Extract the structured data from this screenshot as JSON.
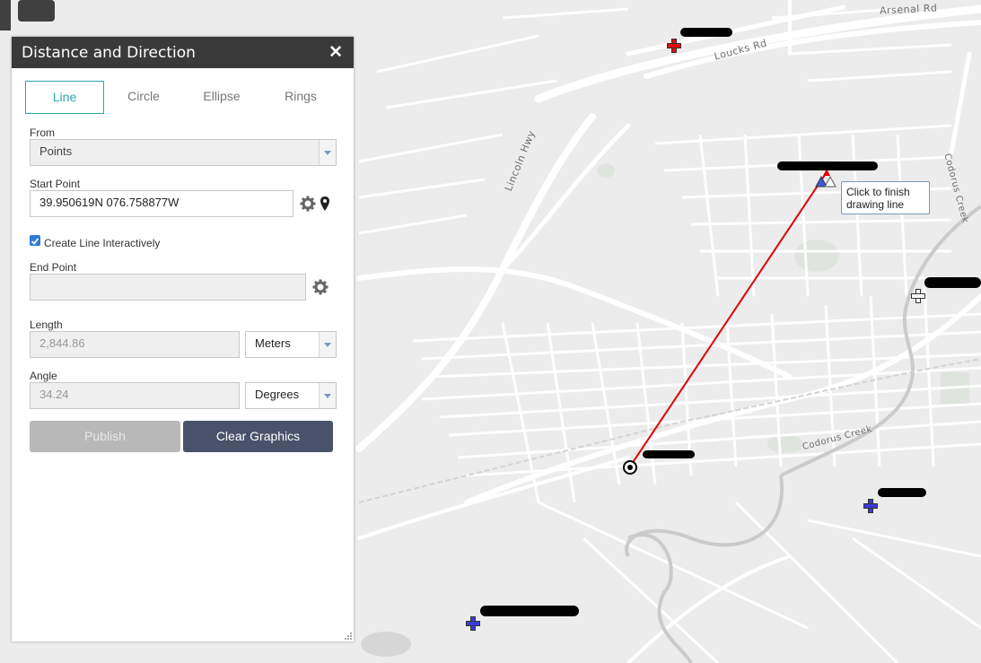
{
  "panel": {
    "title": "Distance and Direction",
    "close_glyph": "✕",
    "tabs": [
      {
        "label": "Line",
        "active": true
      },
      {
        "label": "Circle",
        "active": false
      },
      {
        "label": "Ellipse",
        "active": false
      },
      {
        "label": "Rings",
        "active": false
      }
    ],
    "from": {
      "label": "From",
      "value": "Points"
    },
    "start_point": {
      "label": "Start Point",
      "value": "39.950619N 076.758877W"
    },
    "create_interactive": {
      "label": "Create Line Interactively",
      "checked": true
    },
    "end_point": {
      "label": "End Point",
      "value": ""
    },
    "length": {
      "label": "Length",
      "value": "2,844.86",
      "unit": "Meters"
    },
    "angle": {
      "label": "Angle",
      "value": "34.24",
      "unit": "Degrees"
    },
    "publish_label": "Publish",
    "clear_label": "Clear Graphics"
  },
  "map": {
    "road_labels": [
      "Arsenal Rd",
      "Loucks Rd",
      "Lincoln Hwy",
      "Codorus Creek",
      "Codorus Creek"
    ],
    "tooltip": "Click to finish drawing line",
    "line_color": "#e00000",
    "accent_color": "#2aa6ad",
    "marker_colors": {
      "red_cross": "#e01010",
      "blue_cross": "#3b3bdc",
      "white_cross": "#ffffff"
    }
  }
}
